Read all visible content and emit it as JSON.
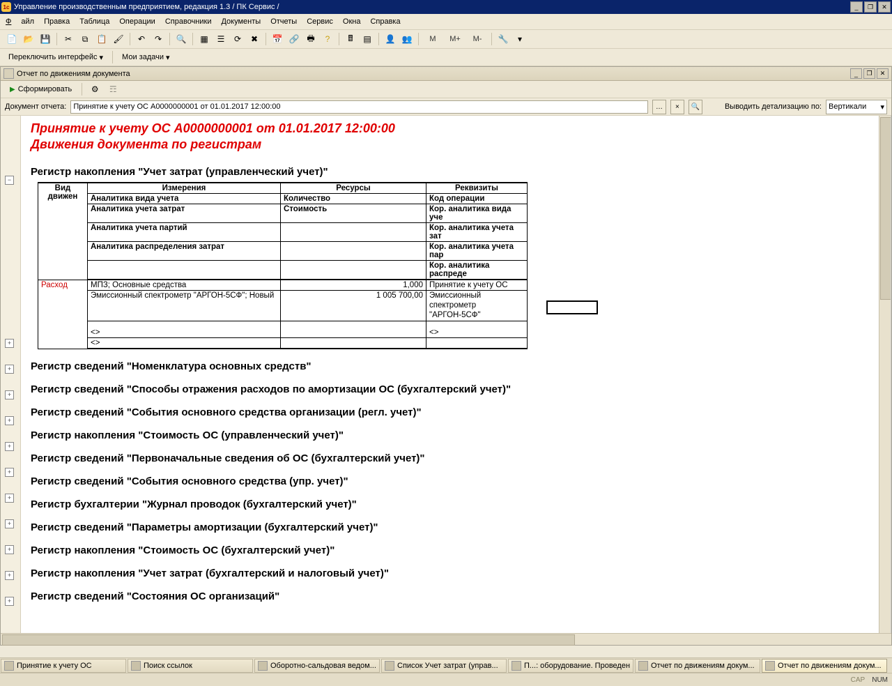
{
  "window": {
    "title": "Управление производственным предприятием, редакция 1.3 / ПК Сервис /"
  },
  "menu": {
    "file": "Файл",
    "edit": "Правка",
    "table": "Таблица",
    "ops": "Операции",
    "refs": "Справочники",
    "docs": "Документы",
    "reports": "Отчеты",
    "service": "Сервис",
    "windows": "Окна",
    "help": "Справка"
  },
  "switchbar": {
    "switch_iface": "Переключить интерфейс",
    "my_tasks": "Мои задачи"
  },
  "toolbar_text": {
    "m": "M",
    "mplus": "M+",
    "mminus": "M-"
  },
  "inner": {
    "title": "Отчет по движениям документа",
    "form_btn": "Сформировать",
    "doc_label": "Документ отчета:",
    "doc_value": "Принятие к учету ОС А0000000001 от 01.01.2017 12:00:00",
    "detail_label": "Выводить детализацию по:",
    "detail_value": "Вертикали"
  },
  "report": {
    "title": "Принятие к учету ОС А0000000001 от 01.01.2017 12:00:00",
    "subtitle": "Движения документа по регистрам",
    "reg1": {
      "heading": "Регистр накопления \"Учет затрат (управленческий учет)\"",
      "col_move": "Вид движен",
      "col_dims": "Измерения",
      "col_res": "Ресурсы",
      "col_attr": "Реквизиты",
      "r1d": "Аналитика вида учета",
      "r1r": "Количество",
      "r1a": "Код операции",
      "r2d": "Аналитика учета затрат",
      "r2r": "Стоимость",
      "r2a": "Кор. аналитика вида уче",
      "r3d": "Аналитика учета партий",
      "r3a": "Кор. аналитика учета зат",
      "r4d": "Аналитика распределения затрат",
      "r4a": "Кор. аналитика учета пар",
      "r5a": "Кор. аналитика распреде",
      "move": "Расход",
      "d1": "МПЗ; Основные средства",
      "v1": "1,000",
      "a1": "Принятие к учету ОС",
      "d2": "Эмиссионный спектрометр \"АРГОН-5СФ\"; Новый",
      "v2": "1 005 700,00",
      "a2": "Эмиссионный спектрометр \"АРГОН-5СФ\"",
      "empty": "<>"
    },
    "sections": [
      "Регистр сведений \"Номенклатура основных средств\"",
      "Регистр сведений \"Способы отражения расходов по амортизации ОС (бухгалтерский учет)\"",
      "Регистр сведений \"События основного средства организации (регл. учет)\"",
      "Регистр накопления \"Стоимость ОС (управленческий учет)\"",
      "Регистр сведений \"Первоначальные сведения об ОС (бухгалтерский учет)\"",
      "Регистр сведений \"События основного средства (упр. учет)\"",
      "Регистр бухгалтерии \"Журнал проводок (бухгалтерский учет)\"",
      "Регистр сведений \"Параметры амортизации (бухгалтерский учет)\"",
      "Регистр накопления \"Стоимость ОС (бухгалтерский учет)\"",
      "Регистр накопления \"Учет затрат (бухгалтерский и налоговый учет)\"",
      "Регистр сведений \"Состояния ОС организаций\""
    ]
  },
  "tasks": [
    "Принятие к учету ОС",
    "Поиск ссылок",
    "Оборотно-сальдовая ведом...",
    "Список Учет затрат (управ...",
    "П...: оборудование. Проведен",
    "Отчет по движениям докум...",
    "Отчет по движениям докум..."
  ],
  "status": {
    "cap": "CAP",
    "num": "NUM"
  }
}
